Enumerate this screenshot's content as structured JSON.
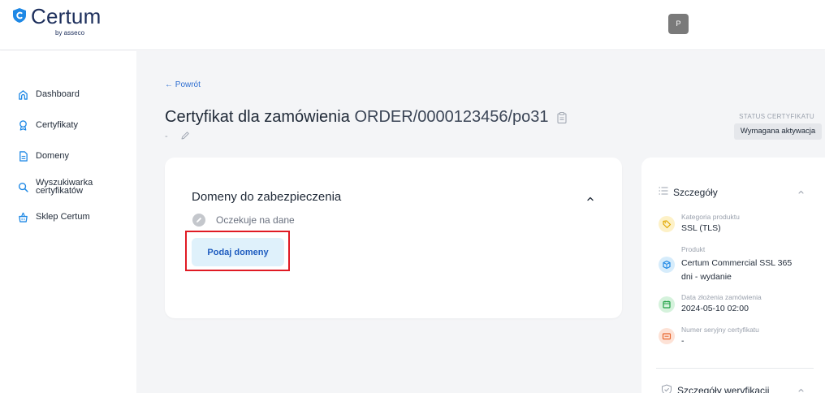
{
  "brand": {
    "name": "Certum",
    "byline": "by asseco",
    "accent": "#1e88e5"
  },
  "user": {
    "avatar_initial": "P"
  },
  "sidebar": {
    "items": [
      {
        "label": "Dashboard",
        "icon": "home-icon"
      },
      {
        "label": "Certyfikaty",
        "icon": "badge-icon"
      },
      {
        "label": "Domeny",
        "icon": "document-icon"
      },
      {
        "label_line1": "Wyszukiwarka",
        "label_line2": "certyfikatów",
        "icon": "search-icon"
      },
      {
        "label": "Sklep Certum",
        "icon": "basket-icon"
      }
    ]
  },
  "page": {
    "back_label": "← Powrót",
    "title_prefix": "Certyfikat dla zamówienia",
    "order_number": "ORDER/0000123456/po31",
    "subtitle": "-",
    "status_label": "STATUS CERTYFIKATU",
    "status_value": "Wymagana aktywacja"
  },
  "domains_card": {
    "title": "Domeny do zabezpieczenia",
    "status_text": "Oczekuje na dane",
    "button_label": "Podaj domeny"
  },
  "details_card": {
    "title": "Szczegóły",
    "items": [
      {
        "label": "Kategoria produktu",
        "value_line1": "SSL (TLS)",
        "value_line2": "",
        "icon": "tag-icon",
        "color": "#fdf1c7",
        "icon_color": "#e0a800"
      },
      {
        "label": "Produkt",
        "value_line1": "Certum Commercial SSL 365",
        "value_line2": "dni - wydanie",
        "icon": "box-icon",
        "color": "#d6ecfb",
        "icon_color": "#1e88e5"
      },
      {
        "label": "Data złożenia zamówienia",
        "value_line1": "2024-05-10 02:00",
        "value_line2": "",
        "icon": "calendar-icon",
        "color": "#d5f2dc",
        "icon_color": "#22a347"
      },
      {
        "label": "Numer seryjny certyfikatu",
        "value_line1": "-",
        "value_line2": "",
        "icon": "serial-icon",
        "color": "#fde2d6",
        "icon_color": "#e8662e"
      }
    ]
  },
  "verification_card": {
    "title": "Szczegóły weryfikacji"
  }
}
